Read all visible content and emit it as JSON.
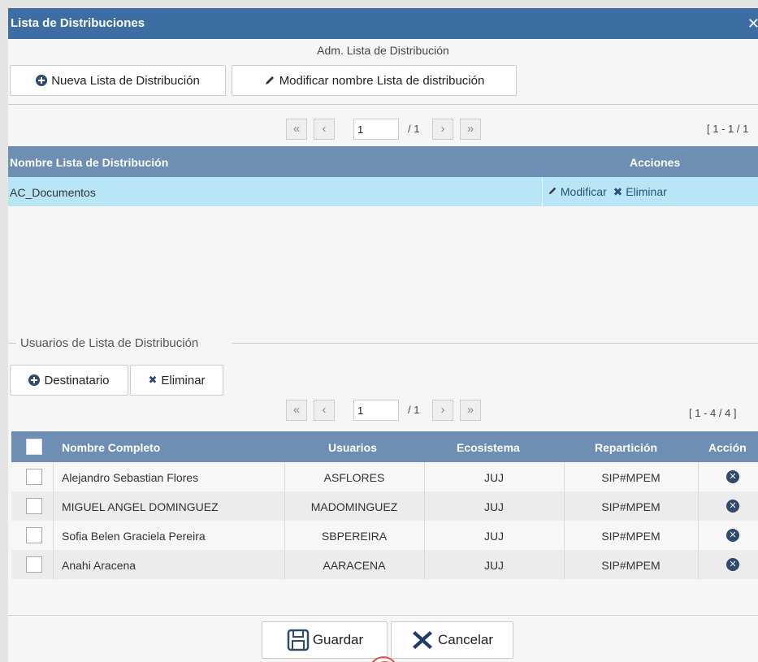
{
  "dialog": {
    "title": "Lista de Distribuciones",
    "close_icon": "close-icon",
    "subtitle": "Adm. Lista de Distribución"
  },
  "toolbar": {
    "new_label": "Nueva Lista de Distribución",
    "rename_label": "Modificar nombre Lista de distribución"
  },
  "pager_top": {
    "first": "«",
    "prev": "‹",
    "page": "1",
    "total": "/ 1",
    "next": "›",
    "last": "»",
    "range": "[ 1 - 1 / 1"
  },
  "lists_table": {
    "columns": [
      "Nombre Lista de Distribución",
      "Acciones"
    ],
    "rows": [
      {
        "name": "AC_Documentos",
        "modify": "Modificar",
        "delete": "Eliminar"
      }
    ]
  },
  "users_section": {
    "legend": "Usuarios de Lista de Distribución",
    "add_label": "Destinatario",
    "delete_label": "Eliminar"
  },
  "pager_bottom": {
    "first": "«",
    "prev": "‹",
    "page": "1",
    "total": "/ 1",
    "next": "›",
    "last": "»",
    "range": "[ 1 - 4 / 4 ]"
  },
  "users_table": {
    "columns": [
      "Nombre Completo",
      "Usuarios",
      "Ecosistema",
      "Repartición",
      "Acción"
    ],
    "rows": [
      {
        "name": "Alejandro Sebastian Flores",
        "user": "ASFLORES",
        "eco": "JUJ",
        "rep": "SIP#MPEM"
      },
      {
        "name": "MIGUEL ANGEL DOMINGUEZ",
        "user": "MADOMINGUEZ",
        "eco": "JUJ",
        "rep": "SIP#MPEM"
      },
      {
        "name": "Sofia Belen Graciela Pereira",
        "user": "SBPEREIRA",
        "eco": "JUJ",
        "rep": "SIP#MPEM"
      },
      {
        "name": "Anahi Aracena",
        "user": "AARACENA",
        "eco": "JUJ",
        "rep": "SIP#MPEM"
      }
    ]
  },
  "footer": {
    "save_label": "Guardar",
    "cancel_label": "Cancelar"
  }
}
